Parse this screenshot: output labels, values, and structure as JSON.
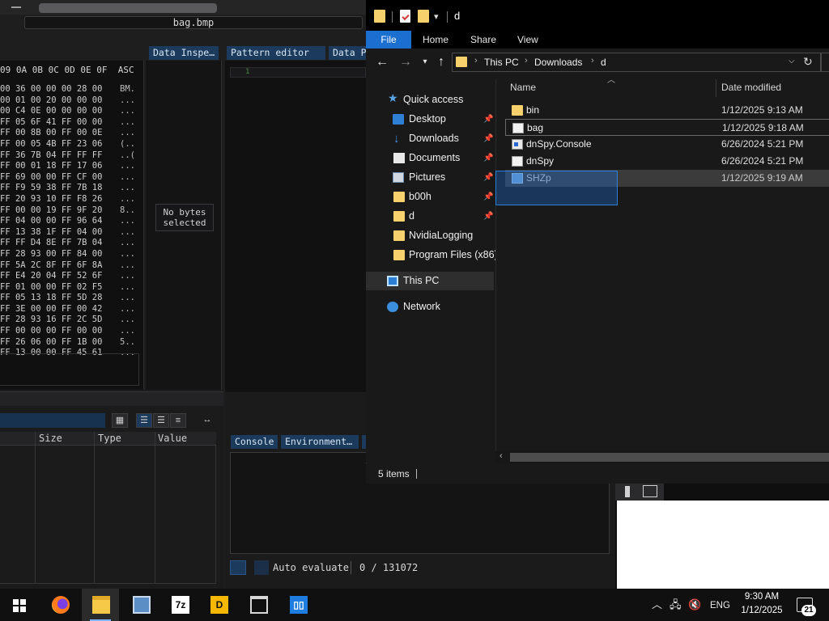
{
  "hex_editor": {
    "file_name": "bag.bmp",
    "header": "09 0A 0B 0C 0D 0E 0F  ASC",
    "rows": [
      {
        "bytes": "00 36 00 00 00 28 00",
        "ascii": "BM."
      },
      {
        "bytes": "00 01 00 20 00 00 00",
        "ascii": "..."
      },
      {
        "bytes": "00 C4 0E 00 00 00 00",
        "ascii": "..."
      },
      {
        "bytes": "FF 05 6F 41 FF 00 00",
        "ascii": "..."
      },
      {
        "bytes": "FF 00 8B 00 FF 00 0E",
        "ascii": "..."
      },
      {
        "bytes": "FF 00 05 4B FF 23 06",
        "ascii": "(.."
      },
      {
        "bytes": "FF 36 7B 04 FF FF FF",
        "ascii": "..("
      },
      {
        "bytes": "FF 00 01 18 FF 17 06",
        "ascii": "..."
      },
      {
        "bytes": "FF 69 00 00 FF CF 00",
        "ascii": "..."
      },
      {
        "bytes": "FF F9 59 38 FF 7B 18",
        "ascii": "..."
      },
      {
        "bytes": "FF 20 93 10 FF F8 26",
        "ascii": "..."
      },
      {
        "bytes": "FF 00 00 19 FF 9F 20",
        "ascii": "8.."
      },
      {
        "bytes": "FF 04 00 00 FF 96 64",
        "ascii": "..."
      },
      {
        "bytes": "FF 13 38 1F FF 04 00",
        "ascii": "..."
      },
      {
        "bytes": "FF FF D4 8E FF 7B 04",
        "ascii": "..."
      },
      {
        "bytes": "FF 28 93 00 FF 84 00",
        "ascii": "..."
      },
      {
        "bytes": "FF 5A 2C 8F FF 6F 8A",
        "ascii": "..."
      },
      {
        "bytes": "FF E4 20 04 FF 52 6F",
        "ascii": "..."
      },
      {
        "bytes": "FF 01 00 00 FF 02 F5",
        "ascii": "..."
      },
      {
        "bytes": "FF 05 13 18 FF 5D 28",
        "ascii": "..."
      },
      {
        "bytes": "FF 3E 00 00 FF 00 42",
        "ascii": "..."
      },
      {
        "bytes": "FF 28 93 16 FF 2C 5D",
        "ascii": "..."
      },
      {
        "bytes": "FF 00 00 00 FF 00 00",
        "ascii": "..."
      },
      {
        "bytes": "FF 26 06 00 FF 1B 00",
        "ascii": "5.."
      },
      {
        "bytes": "FF 13 00 00 FF 45 61",
        "ascii": "..."
      }
    ],
    "tabs": {
      "data_inspector": "Data Inspe…",
      "pattern_editor": "Pattern editor",
      "data_p": "Data P"
    },
    "no_bytes_line1": "No bytes",
    "no_bytes_line2": "selected",
    "pattern_line_number": "1",
    "table_columns": {
      "size": "Size",
      "type": "Type",
      "value": "Value"
    },
    "console_tabs": {
      "console": "Console",
      "environment": "Environment…"
    },
    "auto_evaluate": "Auto evaluate",
    "byte_counter": "0 / 131072"
  },
  "explorer": {
    "title": "d",
    "ribbon": {
      "file": "File",
      "home": "Home",
      "share": "Share",
      "view": "View"
    },
    "address": {
      "this_pc": "This PC",
      "downloads": "Downloads",
      "d": "d"
    },
    "nav": {
      "quick_access": "Quick access",
      "desktop": "Desktop",
      "downloads": "Downloads",
      "documents": "Documents",
      "pictures": "Pictures",
      "b00h": "b00h",
      "d": "d",
      "nvidia_logging": "NvidiaLogging",
      "program_files": "Program Files (x86)",
      "this_pc": "This PC",
      "network": "Network"
    },
    "columns": {
      "name": "Name",
      "date_modified": "Date modified"
    },
    "files": [
      {
        "name": "bin",
        "date": "1/12/2025 9:13 AM"
      },
      {
        "name": "bag",
        "date": "1/12/2025 9:18 AM"
      },
      {
        "name": "dnSpy.Console",
        "date": "6/26/2024 5:21 PM"
      },
      {
        "name": "dnSpy",
        "date": "6/26/2024 5:21 PM"
      },
      {
        "name": "SHZp",
        "date": "1/12/2025 9:19 AM"
      }
    ],
    "status": "5 items"
  },
  "taskbar": {
    "apps": {
      "seven_zip": "7z",
      "debugger": "D"
    },
    "language": "ENG",
    "time": "9:30 AM",
    "date": "1/12/2025",
    "notification_count": "21"
  },
  "colors": {
    "accent": "#1a6fd0",
    "imhex_tab": "#1b3a5c",
    "selection": "#2b7fd8"
  }
}
